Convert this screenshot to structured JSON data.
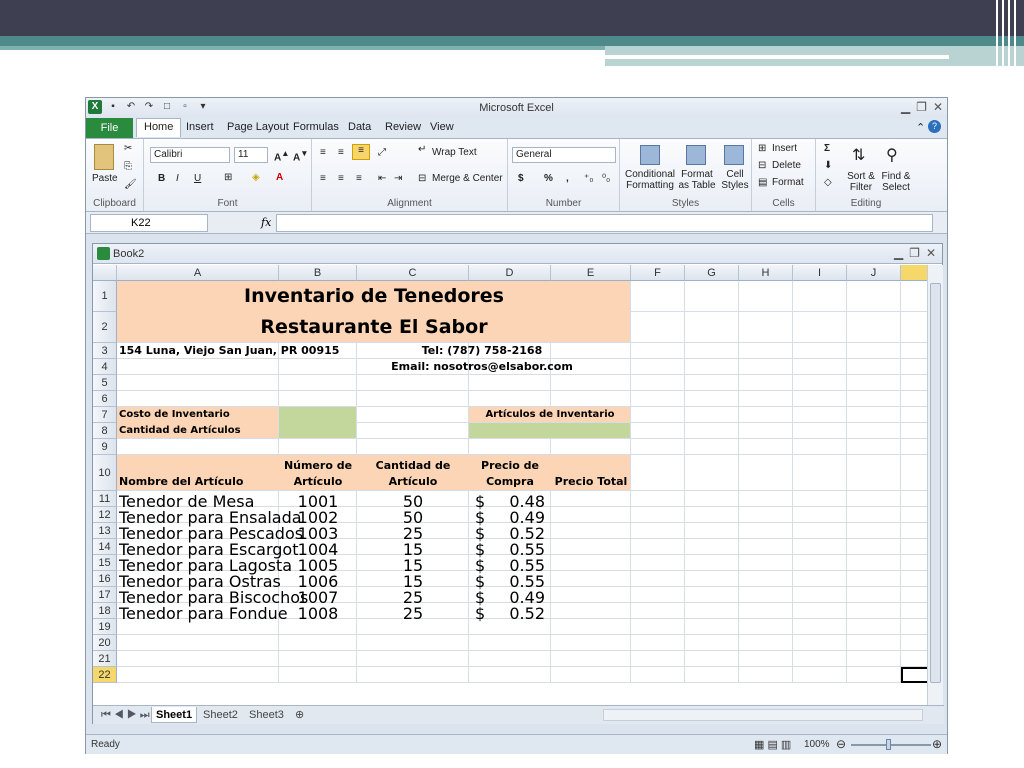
{
  "app": {
    "title": "Microsoft Excel",
    "book_title": "Book2"
  },
  "ribbon_tabs": [
    "File",
    "Home",
    "Insert",
    "Page Layout",
    "Formulas",
    "Data",
    "Review",
    "View"
  ],
  "ribbon": {
    "clipboard": {
      "paste": "Paste",
      "label": "Clipboard"
    },
    "font": {
      "name": "Calibri",
      "size": "11",
      "bold": "B",
      "italic": "I",
      "underline": "U",
      "label": "Font"
    },
    "alignment": {
      "wrap": "Wrap Text",
      "merge": "Merge & Center",
      "label": "Alignment"
    },
    "number": {
      "format": "General",
      "currency": "$",
      "percent": "%",
      "comma": ",",
      "label": "Number"
    },
    "styles": {
      "conditional": "Conditional Formatting",
      "format_table": "Format as Table",
      "cell_styles": "Cell Styles",
      "label": "Styles"
    },
    "cells": {
      "insert": "Insert",
      "delete": "Delete",
      "format": "Format",
      "label": "Cells"
    },
    "editing": {
      "sum": "Σ",
      "sort": "Sort & Filter",
      "find": "Find & Select",
      "label": "Editing"
    }
  },
  "formula_bar": {
    "name_box": "K22",
    "fx": "fx"
  },
  "columns": [
    "A",
    "B",
    "C",
    "D",
    "E",
    "F",
    "G",
    "H",
    "I",
    "J"
  ],
  "rows": [
    "1",
    "2",
    "3",
    "4",
    "5",
    "6",
    "7",
    "8",
    "9",
    "10",
    "11",
    "12",
    "13",
    "14",
    "15",
    "16",
    "17",
    "18",
    "19",
    "20",
    "21",
    "22"
  ],
  "sheet": {
    "title1": "Inventario de Tenedores",
    "title2": "Restaurante El Sabor",
    "address": "154 Luna, Viejo San Juan, PR 00915",
    "tel": "Tel: (787) 758-2168",
    "email": "Email: nosotros@elsabor.com",
    "costo": "Costo de Inventario",
    "cantidad": "Cantidad de Artículos",
    "articulos_inv": "Artículos de Inventario",
    "headers": {
      "a": "Nombre del Artículo",
      "b1": "Número de",
      "b2": "Artículo",
      "c1": "Cantidad de",
      "c2": "Artículo",
      "d1": "Precio de",
      "d2": "Compra",
      "e": "Precio Total"
    },
    "items": [
      {
        "name": "Tenedor de Mesa",
        "num": "1001",
        "qty": "50",
        "cur": "$",
        "price": "0.48"
      },
      {
        "name": "Tenedor para Ensalada",
        "num": "1002",
        "qty": "50",
        "cur": "$",
        "price": "0.49"
      },
      {
        "name": "Tenedor para Pescados",
        "num": "1003",
        "qty": "25",
        "cur": "$",
        "price": "0.52"
      },
      {
        "name": "Tenedor para Escargot",
        "num": "1004",
        "qty": "15",
        "cur": "$",
        "price": "0.55"
      },
      {
        "name": "Tenedor para Lagosta",
        "num": "1005",
        "qty": "15",
        "cur": "$",
        "price": "0.55"
      },
      {
        "name": "Tenedor para Ostras",
        "num": "1006",
        "qty": "15",
        "cur": "$",
        "price": "0.55"
      },
      {
        "name": "Tenedor para Biscochos",
        "num": "1007",
        "qty": "25",
        "cur": "$",
        "price": "0.49"
      },
      {
        "name": "Tenedor para Fondue",
        "num": "1008",
        "qty": "25",
        "cur": "$",
        "price": "0.52"
      }
    ]
  },
  "sheet_tabs": [
    "Sheet1",
    "Sheet2",
    "Sheet3"
  ],
  "status": {
    "ready": "Ready",
    "zoom": "100%"
  },
  "colors": {
    "peach": "#fbd5b5",
    "green": "#c3d69b",
    "file_tab": "#2a8a3e"
  }
}
